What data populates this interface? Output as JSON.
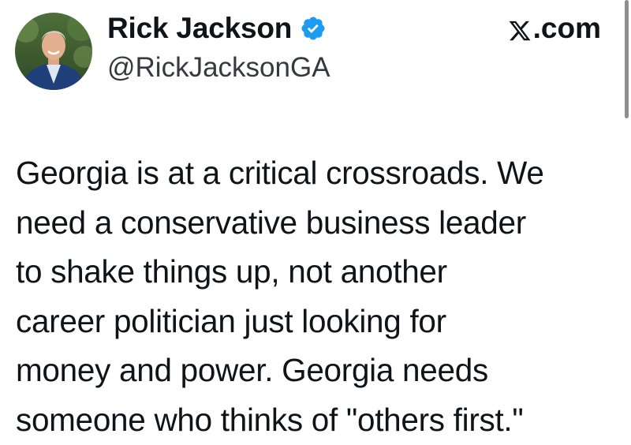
{
  "author": {
    "name": "Rick Jackson",
    "handle": "@RickJacksonGA",
    "verified": true,
    "avatar_icon": "profile-photo"
  },
  "source": {
    "logo_icon": "x-logo-icon",
    "label": ".com"
  },
  "tweet": {
    "lines": [
      "Georgia is at a critical crossroads. We",
      "need a conservative business leader",
      "to shake things up, not another",
      "career politician just looking for",
      "money and power. Georgia needs",
      "someone who thinks of \"others first.\""
    ]
  },
  "colors": {
    "text": "#0f1419",
    "handle": "#36393d",
    "verified": "#1d9bf0",
    "background": "#ffffff"
  }
}
